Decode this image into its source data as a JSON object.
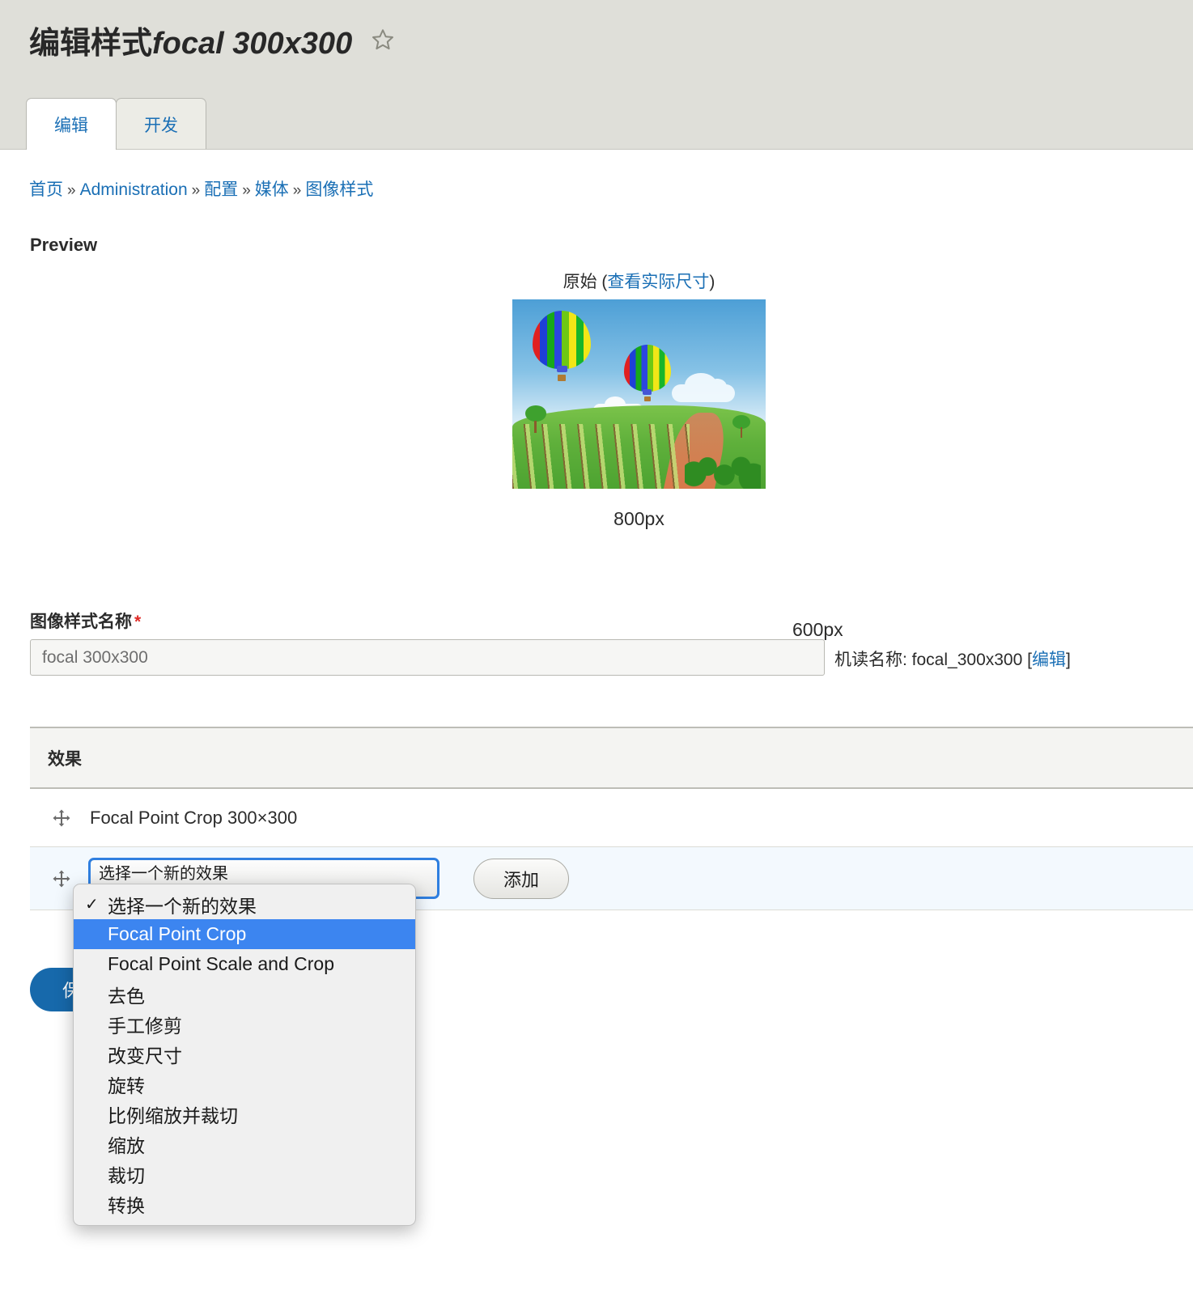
{
  "header": {
    "title_prefix": "编辑样式",
    "style_name": "focal 300x300",
    "star_icon": "star-outline-icon"
  },
  "tabs": [
    {
      "label": "编辑",
      "active": true
    },
    {
      "label": "开发",
      "active": false
    }
  ],
  "breadcrumb": {
    "items": [
      "首页",
      "Administration",
      "配置",
      "媒体",
      "图像样式"
    ],
    "separator": "»"
  },
  "preview": {
    "section_label": "Preview",
    "caption_prefix": "原始 (",
    "caption_link": "查看实际尺寸",
    "caption_suffix": ")",
    "height_label": "600px",
    "width_label": "800px"
  },
  "name_field": {
    "label": "图像样式名称",
    "required_mark": "*",
    "value": "focal 300x300",
    "machine_name_prefix": "机读名称: ",
    "machine_name_value": "focal_300x300",
    "machine_name_edit_open": "[",
    "machine_name_edit": "编辑",
    "machine_name_edit_close": "]"
  },
  "effects": {
    "table_header": "效果",
    "rows": [
      {
        "label": "Focal Point Crop 300×300",
        "drag_icon": "drag-move-icon"
      }
    ],
    "new_row": {
      "drag_icon": "drag-move-icon",
      "select_value": "选择一个新的效果",
      "add_button": "添加"
    }
  },
  "dropdown": {
    "open": true,
    "items": [
      {
        "label": "选择一个新的效果",
        "checked": true,
        "highlighted": false
      },
      {
        "label": "Focal Point Crop",
        "checked": false,
        "highlighted": true
      },
      {
        "label": "Focal Point Scale and Crop",
        "checked": false,
        "highlighted": false
      },
      {
        "label": "去色",
        "checked": false,
        "highlighted": false
      },
      {
        "label": "手工修剪",
        "checked": false,
        "highlighted": false
      },
      {
        "label": "改变尺寸",
        "checked": false,
        "highlighted": false
      },
      {
        "label": "旋转",
        "checked": false,
        "highlighted": false
      },
      {
        "label": "比例缩放并裁切",
        "checked": false,
        "highlighted": false
      },
      {
        "label": "缩放",
        "checked": false,
        "highlighted": false
      },
      {
        "label": "裁切",
        "checked": false,
        "highlighted": false
      },
      {
        "label": "转换",
        "checked": false,
        "highlighted": false
      }
    ],
    "check_glyph": "✓"
  },
  "actions": {
    "save_label": "保存"
  },
  "colors": {
    "header_band": "#dfdfd9",
    "link": "#1a6fb5",
    "primary_button": "#1769ab",
    "required": "#e02b27",
    "dropdown_highlight": "#3c85f0",
    "new_row_background": "#f3f9fe"
  }
}
